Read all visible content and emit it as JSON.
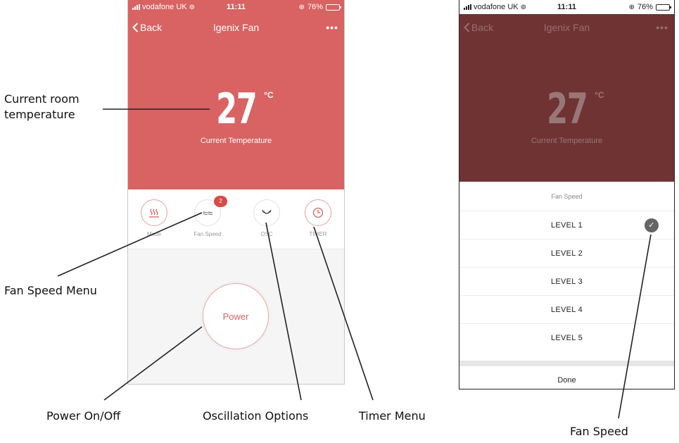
{
  "status_bar": {
    "carrier": "vodafone UK",
    "time": "11:11",
    "battery": "76%",
    "battery_level": 0.76
  },
  "nav": {
    "back_label": "Back",
    "title": "Igenix Fan",
    "more_label": "•••"
  },
  "temperature": {
    "value": "27",
    "unit": "°C",
    "label": "Current Temperature"
  },
  "controls": [
    {
      "label": "Mode",
      "icon": "heat-mode-icon"
    },
    {
      "label": "Fan Speed",
      "icon": "fan-wind-icon",
      "badge": "2"
    },
    {
      "label": "OSC",
      "icon": "oscillation-icon"
    },
    {
      "label": "TIMER",
      "icon": "clock-icon"
    }
  ],
  "power": {
    "label": "Power"
  },
  "fan_speed_sheet": {
    "title": "Fan Speed",
    "options": [
      "LEVEL 1",
      "LEVEL 2",
      "LEVEL 3",
      "LEVEL 4",
      "LEVEL 5"
    ],
    "selected_index": 0,
    "done_label": "Done"
  },
  "annotations": {
    "current_temp_line1": "Current room",
    "current_temp_line2": "temperature",
    "fan_speed_menu": "Fan Speed Menu",
    "power": "Power On/Off",
    "oscillation": "Oscillation Options",
    "timer": "Timer Menu",
    "fan_speed": "Fan Speed"
  },
  "colors": {
    "accent": "#d96262",
    "dimmed_hero": "#6f3334",
    "badge": "#d94a4a"
  }
}
